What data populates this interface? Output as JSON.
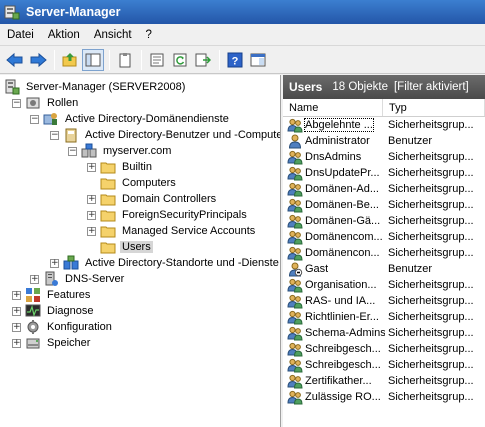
{
  "window": {
    "title": "Server-Manager"
  },
  "menu": [
    "Datei",
    "Aktion",
    "Ansicht",
    "?"
  ],
  "toolbar": {
    "buttons": [
      "back-icon",
      "forward-icon",
      "up-folder-icon",
      "show-tree-icon",
      "clipboard-icon",
      "properties-icon",
      "refresh-icon",
      "export-icon",
      "help-icon",
      "console-icon"
    ]
  },
  "tree": {
    "root": "Server-Manager (SERVER2008)",
    "rollen": "Rollen",
    "ad_ds": "Active Directory-Domänendienste",
    "ad_users": "Active Directory-Benutzer und -Compute",
    "domain": "myserver.com",
    "builtin": "Builtin",
    "computers": "Computers",
    "domain_controllers": "Domain Controllers",
    "foreign": "ForeignSecurityPrincipals",
    "msa": "Managed Service Accounts",
    "users": "Users",
    "ad_sites": "Active Directory-Standorte und -Dienste",
    "dns": "DNS-Server",
    "features": "Features",
    "diagnose": "Diagnose",
    "konfiguration": "Konfiguration",
    "speicher": "Speicher"
  },
  "list": {
    "title": "Users",
    "count": "18 Objekte",
    "filter": "[Filter aktiviert]",
    "columns": {
      "name": "Name",
      "type": "Typ"
    },
    "rows": [
      {
        "name": "Abgelehnte ...",
        "type": "Sicherheitsgrup...",
        "icon": "group"
      },
      {
        "name": "Administrator",
        "type": "Benutzer",
        "icon": "user"
      },
      {
        "name": "DnsAdmins",
        "type": "Sicherheitsgrup...",
        "icon": "group"
      },
      {
        "name": "DnsUpdatePr...",
        "type": "Sicherheitsgrup...",
        "icon": "group"
      },
      {
        "name": "Domänen-Ad...",
        "type": "Sicherheitsgrup...",
        "icon": "group"
      },
      {
        "name": "Domänen-Be...",
        "type": "Sicherheitsgrup...",
        "icon": "group"
      },
      {
        "name": "Domänen-Gä...",
        "type": "Sicherheitsgrup...",
        "icon": "group"
      },
      {
        "name": "Domänencom...",
        "type": "Sicherheitsgrup...",
        "icon": "group"
      },
      {
        "name": "Domänencon...",
        "type": "Sicherheitsgrup...",
        "icon": "group"
      },
      {
        "name": "Gast",
        "type": "Benutzer",
        "icon": "user-disabled"
      },
      {
        "name": "Organisation...",
        "type": "Sicherheitsgrup...",
        "icon": "group"
      },
      {
        "name": "RAS- und IA...",
        "type": "Sicherheitsgrup...",
        "icon": "group"
      },
      {
        "name": "Richtlinien-Er...",
        "type": "Sicherheitsgrup...",
        "icon": "group"
      },
      {
        "name": "Schema-Admins",
        "type": "Sicherheitsgrup...",
        "icon": "group"
      },
      {
        "name": "Schreibgesch...",
        "type": "Sicherheitsgrup...",
        "icon": "group"
      },
      {
        "name": "Schreibgesch...",
        "type": "Sicherheitsgrup...",
        "icon": "group"
      },
      {
        "name": "Zertifikather...",
        "type": "Sicherheitsgrup...",
        "icon": "group"
      },
      {
        "name": "Zulässige RO...",
        "type": "Sicherheitsgrup...",
        "icon": "group"
      }
    ]
  }
}
